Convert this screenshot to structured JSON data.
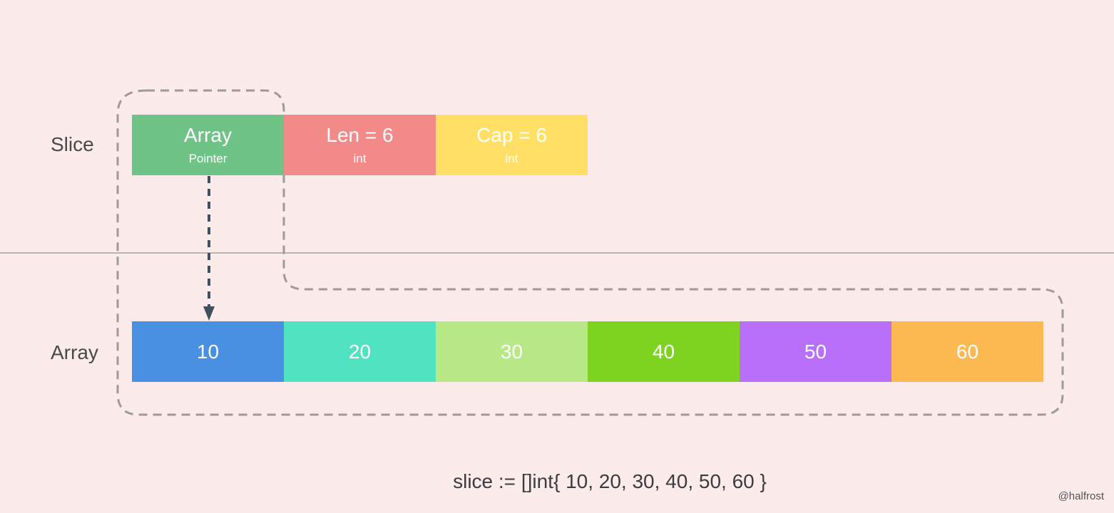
{
  "labels": {
    "slice": "Slice",
    "array": "Array"
  },
  "slice_header": [
    {
      "title": "Array",
      "type": "Pointer",
      "color": "#6fc387"
    },
    {
      "title": "Len = 6",
      "type": "int",
      "color": "#f18a88"
    },
    {
      "title": "Cap = 6",
      "type": "int",
      "color": "#ffdf65"
    }
  ],
  "array": [
    {
      "value": "10",
      "color": "#4a90e2"
    },
    {
      "value": "20",
      "color": "#50e3c2"
    },
    {
      "value": "30",
      "color": "#b8e986"
    },
    {
      "value": "40",
      "color": "#7ed321"
    },
    {
      "value": "50",
      "color": "#b870fb"
    },
    {
      "value": "60",
      "color": "#fcb851"
    }
  ],
  "code": "slice := []int{ 10, 20, 30, 40, 50, 60 }",
  "credit": "@halfrost",
  "colors": {
    "background": "#fbebeb",
    "divider": "#b8b4b2",
    "dashed_outline": "#9e9a99",
    "arrow": "#3f515e"
  }
}
